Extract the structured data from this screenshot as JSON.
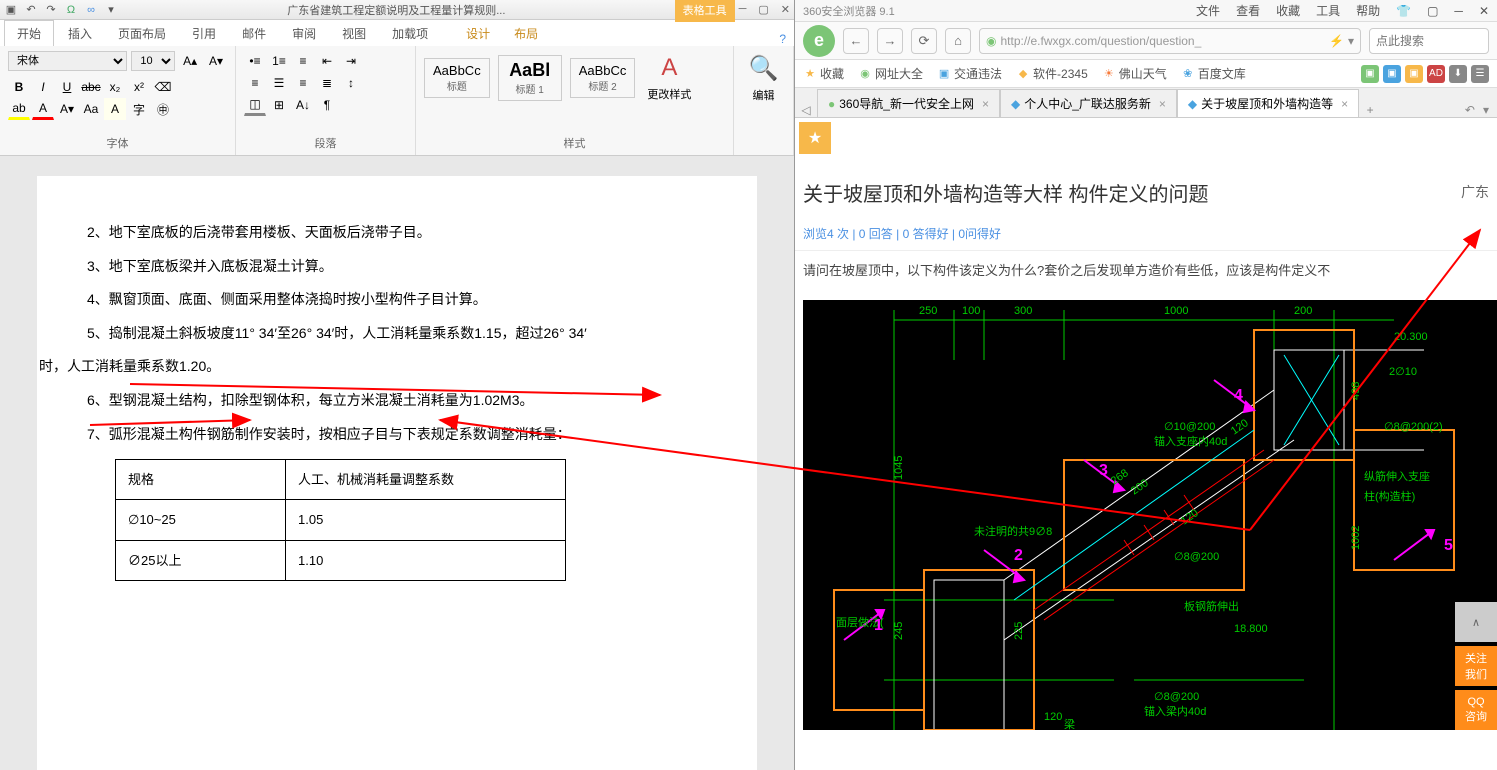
{
  "word": {
    "doc_title": "广东省建筑工程定额说明及工程量计算规则...",
    "contextual_label": "表格工具",
    "tabs": [
      "开始",
      "插入",
      "页面布局",
      "引用",
      "邮件",
      "审阅",
      "视图",
      "加载项"
    ],
    "ctx_tabs": [
      "设计",
      "布局"
    ],
    "font_name": "宋体",
    "font_size": "10",
    "groups": {
      "font": "字体",
      "paragraph": "段落",
      "styles": "样式",
      "editing": "编辑"
    },
    "styles": [
      {
        "preview": "AaBbCc",
        "name": "标题"
      },
      {
        "preview": "AaBl",
        "name": "标题 1"
      },
      {
        "preview": "AaBbCc",
        "name": "标题 2"
      }
    ],
    "change_style": "更改样式",
    "editing": "编辑",
    "body": {
      "lines": [
        "2、地下室底板的后浇带套用楼板、天面板后浇带子目。",
        "3、地下室底板梁并入底板混凝土计算。",
        "4、飘窗顶面、底面、侧面采用整体浇捣时按小型构件子目计算。",
        "5、捣制混凝土斜板坡度11° 34′至26° 34′时，人工消耗量乘系数1.15，超过26° 34′",
        "时，人工消耗量乘系数1.20。",
        "6、型钢混凝土结构，扣除型钢体积，每立方米混凝土消耗量为1.02M3。",
        "7、弧形混凝土构件钢筋制作安装时，按相应子目与下表规定系数调整消耗量："
      ],
      "table_header": [
        "规格",
        "人工、机械消耗量调整系数"
      ],
      "table_rows": [
        [
          "∅10~25",
          "1.05"
        ],
        [
          "∅25以上",
          "1.10"
        ]
      ]
    }
  },
  "browser": {
    "name": "360安全浏览器 9.1",
    "menu": [
      "文件",
      "查看",
      "收藏",
      "工具",
      "帮助"
    ],
    "url": "http://e.fwxgx.com/question/question_",
    "search_placeholder": "点此搜索",
    "bookmarks": [
      {
        "icon": "★",
        "label": "收藏",
        "color": "#7cc576"
      },
      {
        "icon": "◉",
        "label": "网址大全",
        "color": "#7cc576"
      },
      {
        "icon": "▣",
        "label": "交通违法",
        "color": "#4aa3df"
      },
      {
        "icon": "◆",
        "label": "软件-2345",
        "color": "#f7b84a"
      },
      {
        "icon": "☀",
        "label": "佛山天气",
        "color": "#f77a3a"
      },
      {
        "icon": "❀",
        "label": "百度文库",
        "color": "#4aa3df"
      }
    ],
    "tabs": [
      {
        "icon": "●",
        "label": "360导航_新一代安全上网",
        "active": false
      },
      {
        "icon": "◆",
        "label": "个人中心_广联达服务新",
        "active": false
      },
      {
        "icon": "◆",
        "label": "关于坡屋顶和外墙构造等",
        "active": true
      }
    ],
    "page": {
      "title": "关于坡屋顶和外墙构造等大样 构件定义的问题",
      "region": "广东",
      "stats": "浏览4 次 | 0 回答 | 0 答得好 | 0问得好",
      "body": "请问在坡屋顶中，以下构件该定义为什么?套价之后发现单方造价有些低，应该是构件定义不"
    },
    "cad": {
      "dims_top": [
        "250",
        "100",
        "300",
        "1000",
        "200"
      ],
      "labels": [
        {
          "t": "20.300"
        },
        {
          "t": "2∅10"
        },
        {
          "t": "∅8@200(2)"
        },
        {
          "t": "∅10@200"
        },
        {
          "t": "锚入支座内40d"
        },
        {
          "t": "未注明的共9∅8"
        },
        {
          "t": "∅8@200"
        },
        {
          "t": "梁"
        },
        {
          "t": "板钢筋伸出"
        },
        {
          "t": "18.800"
        },
        {
          "t": "∅8@200"
        },
        {
          "t": "锚入梁内40d"
        },
        {
          "t": "纵筋伸入支座"
        },
        {
          "t": "柱(构造柱)"
        },
        {
          "t": "498"
        },
        {
          "t": "1002"
        }
      ],
      "markers": [
        "1",
        "2",
        "3",
        "4",
        "5"
      ],
      "dims_side": [
        "1045",
        "245",
        "225",
        "200",
        "120",
        "120",
        "268",
        "120"
      ]
    },
    "badges": {
      "top": "∧",
      "follow": "关注\n我们",
      "qq": "QQ\n咨询"
    }
  }
}
